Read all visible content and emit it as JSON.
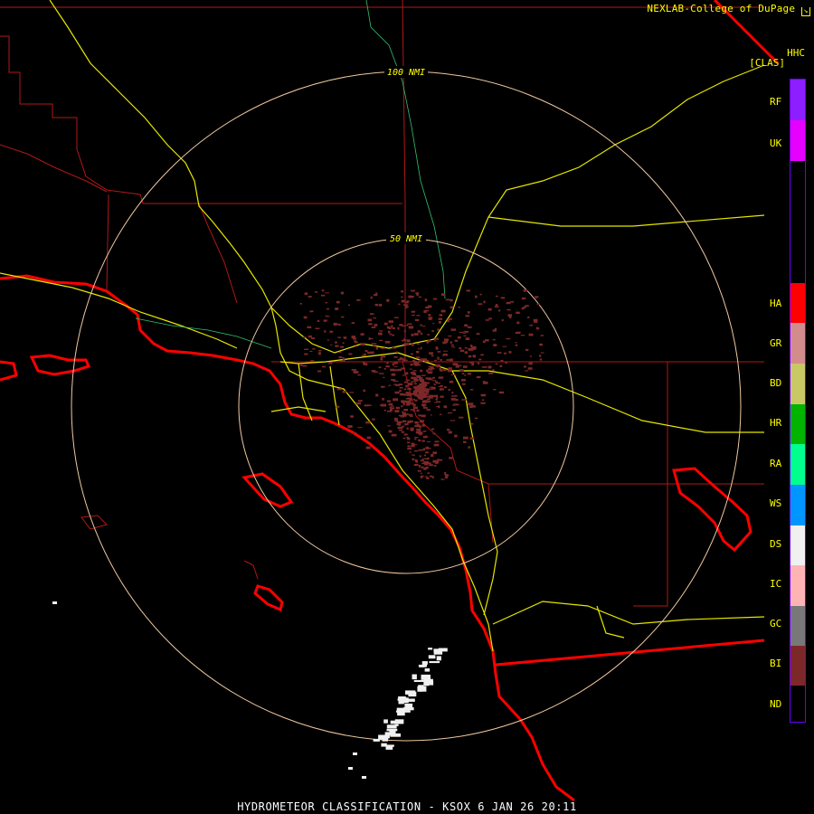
{
  "header": {
    "credit": "NEXLAB-College of DuPage",
    "credit_icon": "cod-logo-icon",
    "product_code": "HHC",
    "classification_label": "[CLAS]"
  },
  "range_rings": {
    "inner_label": "50 NMI",
    "outer_label": "100 NMI"
  },
  "legend": {
    "items": [
      {
        "code": "RF",
        "color": "#8c1eff"
      },
      {
        "code": "UK",
        "color": "#e600ff"
      },
      {
        "code": "HA",
        "color": "#ff0000"
      },
      {
        "code": "GR",
        "color": "#d28c8c"
      },
      {
        "code": "BD",
        "color": "#c8c864"
      },
      {
        "code": "HR",
        "color": "#00b400"
      },
      {
        "code": "RA",
        "color": "#00ff8c"
      },
      {
        "code": "WS",
        "color": "#0096ff"
      },
      {
        "code": "DS",
        "color": "#f0f0f0"
      },
      {
        "code": "IC",
        "color": "#ffb4b4"
      },
      {
        "code": "GC",
        "color": "#787878"
      },
      {
        "code": "BI",
        "color": "#7d2828"
      },
      {
        "code": "ND",
        "color": "#000000"
      }
    ]
  },
  "footer": {
    "title": "HYDROMETEOR CLASSIFICATION - KSOX 6 JAN 26 20:11"
  },
  "colors": {
    "county_lines": "#b01818",
    "coastline": "#ff0000",
    "highways": "#ffff00",
    "range_rings": "#f0c8a0",
    "biological_echo": "#7d2828",
    "dry_snow_echo": "#f0f0f0"
  }
}
